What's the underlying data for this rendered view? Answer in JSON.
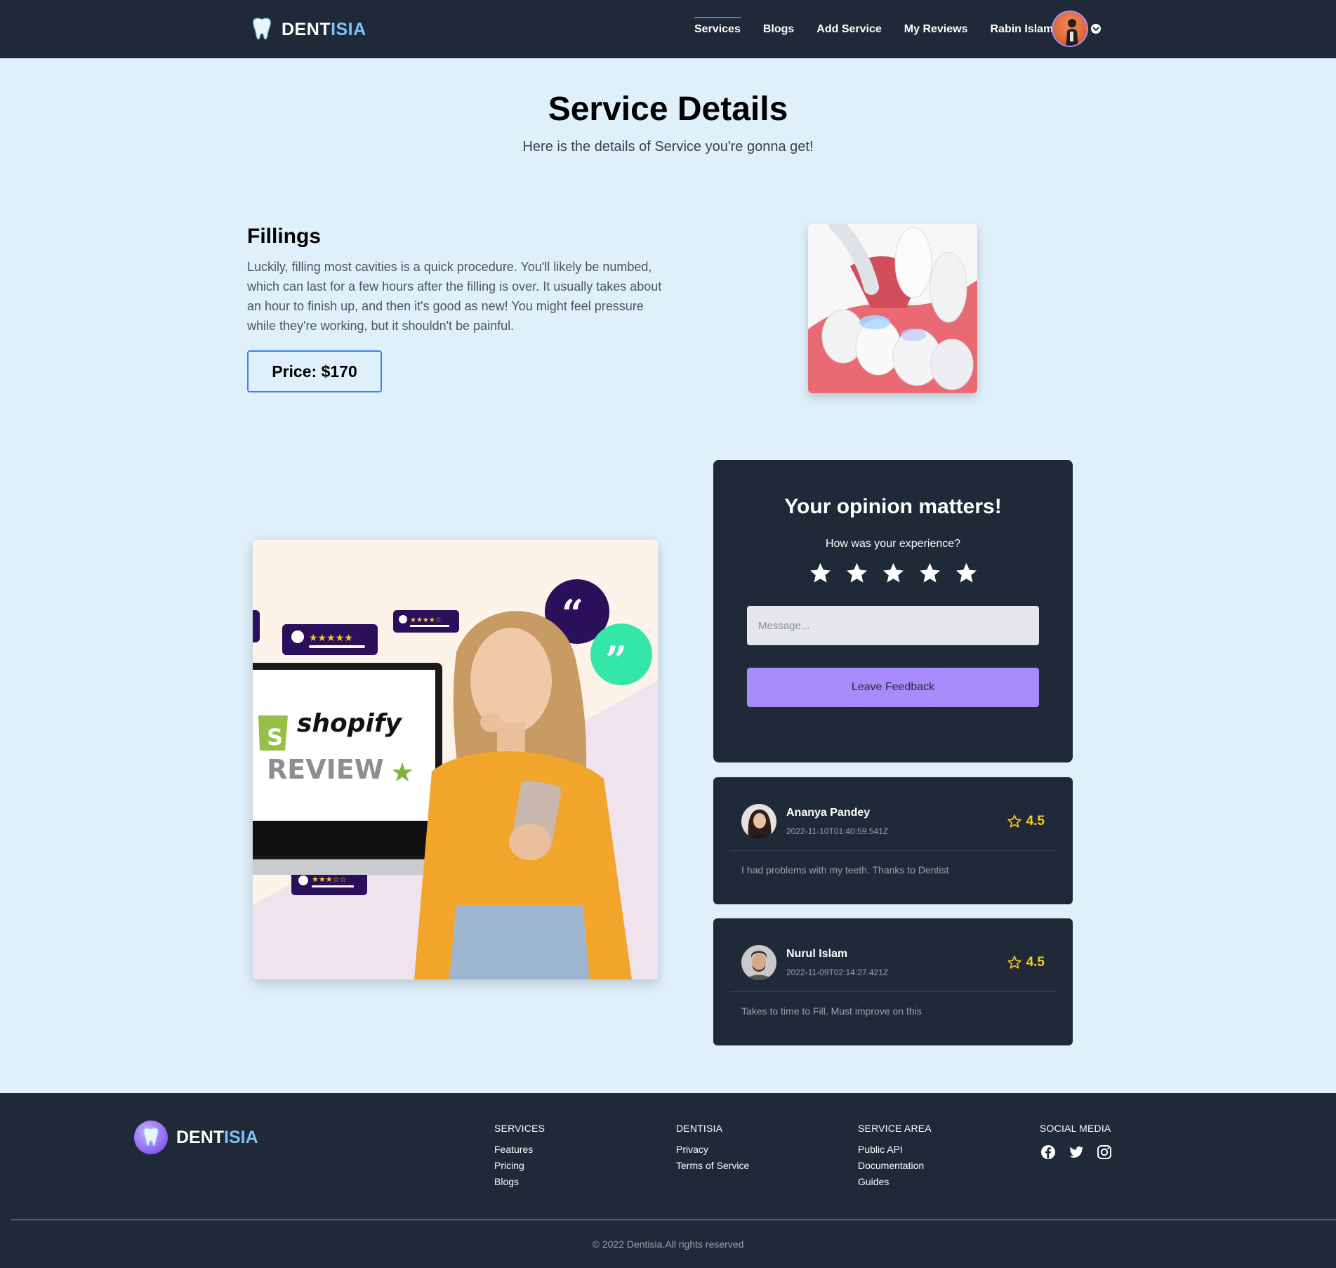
{
  "nav": {
    "brand_part1": "DENT",
    "brand_part2": "ISIA",
    "links": [
      "Services",
      "Blogs",
      "Add Service",
      "My Reviews",
      "Rabin Islam"
    ],
    "active_index": 0
  },
  "hero": {
    "title": "Service Details",
    "subtitle": "Here is the details of Service you're gonna get!"
  },
  "service": {
    "name": "Fillings",
    "description": "Luckily, filling most cavities is a quick procedure. You'll likely be numbed, which can last for a few hours after the filling is over. It usually takes about an hour to finish up, and then it's good as new! You might feel pressure while they're working, but it shouldn't be painful.",
    "price_label": "Price: $170"
  },
  "illustration": {
    "brand": "shopify",
    "word": "REVIEW"
  },
  "feedback": {
    "title": "Your opinion matters!",
    "question": "How was your experience?",
    "stars": 5,
    "message_placeholder": "Message...",
    "button_label": "Leave Feedback"
  },
  "reviews": [
    {
      "name": "Ananya Pandey",
      "date": "2022-11-10T01:40:59.541Z",
      "rating": "4.5",
      "text": "I had problems with my teeth. Thanks to Dentist"
    },
    {
      "name": "Nurul Islam",
      "date": "2022-11-09T02:14:27.421Z",
      "rating": "4.5",
      "text": "Takes to time to Fill. Must improve on this"
    }
  ],
  "footer": {
    "brand_part1": "DENT",
    "brand_part2": "ISIA",
    "columns": [
      {
        "title": "SERVICES",
        "links": [
          "Features",
          "Pricing",
          "Blogs"
        ]
      },
      {
        "title": "DENTISIA",
        "links": [
          "Privacy",
          "Terms of Service"
        ]
      },
      {
        "title": "SERVICE AREA",
        "links": [
          "Public API",
          "Documentation",
          "Guides"
        ]
      },
      {
        "title": "SOCIAL MEDIA",
        "icons": [
          "facebook-icon",
          "twitter-icon",
          "instagram-icon"
        ]
      }
    ],
    "copyright": "© 2022 Dentisia.All rights reserved"
  },
  "colors": {
    "navy": "#1f2937",
    "page_bg": "#dff0fb",
    "accent_blue": "#3b82f6",
    "accent_purple": "#a78bfa",
    "rating_yellow": "#facc15",
    "brand_light_blue": "#7cc3f5"
  }
}
